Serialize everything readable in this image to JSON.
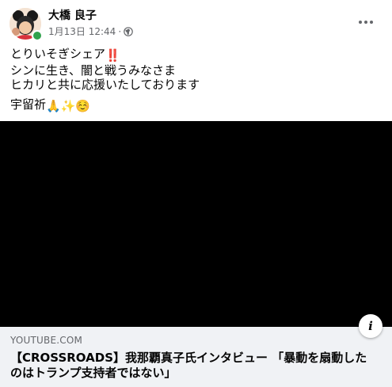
{
  "post": {
    "author": "大橋 良子",
    "date": "1月13日 12:44",
    "separator": "·",
    "audience_icon": "globe-icon",
    "body_lines": [
      "とりいそぎシェア",
      "シンに生き、闇と戦うみなさま",
      "ヒカリと共に応援いたしております"
    ],
    "closing": "宇留祈",
    "emoji": {
      "exclamation": "‼️",
      "pray": "🙏",
      "sparkles": "✨",
      "smile": "☺️"
    }
  },
  "link": {
    "domain": "YOUTUBE.COM",
    "title": "【CROSSROADS】我那覇真子氏インタビュー 「暴動を扇動したのはトランプ支持者ではない」",
    "info_label": "i"
  },
  "colors": {
    "online": "#31a24c",
    "secondary_text": "#65676b",
    "card_bg": "#f0f2f5",
    "video_bg": "#000000"
  }
}
